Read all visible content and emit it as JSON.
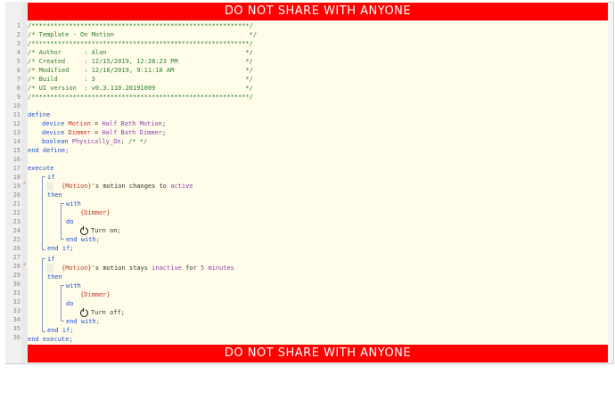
{
  "banner": {
    "top_text": "DO NOT SHARE WITH ANYONE",
    "bottom_text": "DO NOT SHARE WITH ANYONE"
  },
  "line_numbers": [
    "1",
    "2",
    "3",
    "4",
    "5",
    "6",
    "7",
    "8",
    "9",
    "10",
    "11",
    "12",
    "13",
    "14",
    "15",
    "16",
    "17",
    "18",
    "19",
    "20",
    "21",
    "22",
    "23",
    "24",
    "25",
    "26",
    "27",
    "28",
    "29",
    "30",
    "31",
    "32",
    "33",
    "34",
    "35",
    "36"
  ],
  "markers": {
    "19": "⚡",
    "28": "⚡"
  },
  "header": {
    "rule": "/**********************************************************/",
    "template_line": "/* Template - On Motion                                    */",
    "rule2": "/**********************************************************/",
    "author": "/* Author      : Alan                                     */",
    "created": "/* Created     : 12/15/2019, 12:28:23 PM                  */",
    "modified": "/* Modified    : 12/16/2019, 9:11:10 AM                   */",
    "build": "/* Build       : 3                                        */",
    "ui_version": "/* UI version  : v0.3.110.20191009                        */",
    "rule3": "/**********************************************************/"
  },
  "code": {
    "define": "define",
    "dev1_type": "device",
    "dev1_name": "Motion",
    "dev1_eq": " = ",
    "dev1_val": "Half Bath Motion",
    "semi": ";",
    "dev2_type": "device",
    "dev2_name": "Dimmer",
    "dev2_eq": " = ",
    "dev2_val": "Half Bath Dimmer",
    "bool_type": "boolean",
    "bool_name": "Physically_On",
    "bool_cmt": "; /* */",
    "end_define": "end define;",
    "execute": "execute",
    "if1": "if",
    "cond1_dev": "{Motion}",
    "cond1_mid": "'s motion changes to ",
    "cond1_val": "active",
    "then1": "then",
    "with1": "with",
    "with1_dev": "{Dimmer}",
    "do1": "do",
    "act1": "Turn on;",
    "endwith1": "end with;",
    "endif1": "end if;",
    "if2": "if",
    "cond2_dev": "{Motion}",
    "cond2_mid": "'s motion stays ",
    "cond2_val": "inactive",
    "cond2_for": " for ",
    "cond2_num": "5",
    "cond2_unit": " minutes",
    "then2": "then",
    "with2": "with",
    "with2_dev": "{Dimmer}",
    "do2": "do",
    "act2": "Turn off;",
    "endwith2": "end with;",
    "endif2": "end if;",
    "end_execute": "end execute;"
  }
}
